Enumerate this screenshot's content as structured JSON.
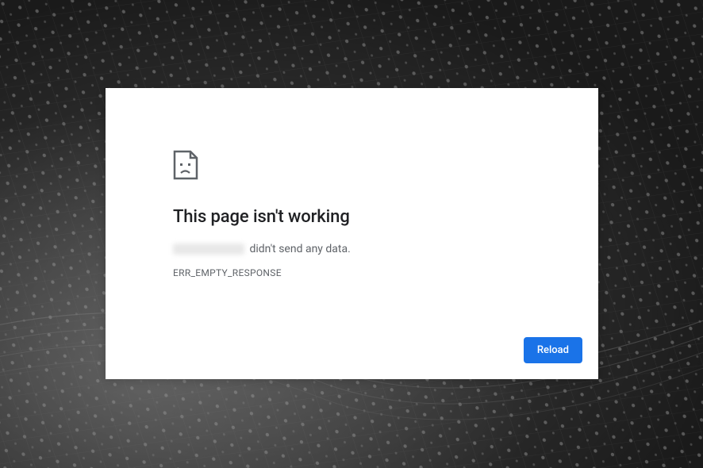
{
  "error": {
    "title": "This page isn't working",
    "message_suffix": "didn't send any data.",
    "code": "ERR_EMPTY_RESPONSE",
    "reload_label": "Reload"
  }
}
